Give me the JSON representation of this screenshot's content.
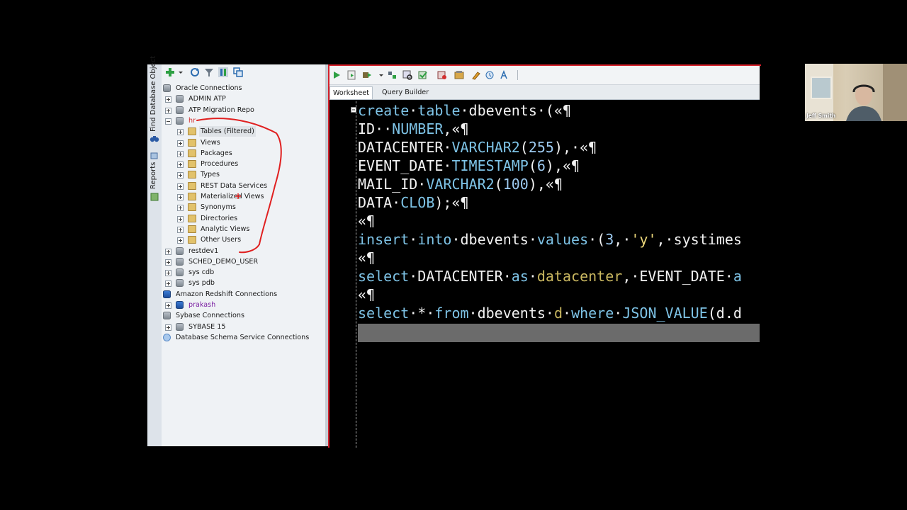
{
  "side_tabs": {
    "find": "Find Database Object",
    "reports": "Reports"
  },
  "connections": {
    "toolbar_icons": [
      "add-icon",
      "dropdown-icon",
      "refresh-icon",
      "filter-icon",
      "schema-browser-icon",
      "collapse-icon"
    ],
    "tree": [
      {
        "label": "Oracle Connections",
        "level": 0,
        "icon": "db-group",
        "expander": "none",
        "color": "#1a1a1a"
      },
      {
        "label": "ADMIN ATP",
        "level": 1,
        "icon": "db",
        "expander": "plus",
        "color": "#1a1a1a"
      },
      {
        "label": "ATP Migration Repo",
        "level": 1,
        "icon": "db",
        "expander": "plus",
        "color": "#1a1a1a"
      },
      {
        "label": "hr",
        "level": 1,
        "icon": "db",
        "expander": "minus",
        "color": "#d32f2f"
      },
      {
        "label": "Tables (Filtered)",
        "level": 2,
        "icon": "folder",
        "expander": "plus",
        "color": "#1a1a1a",
        "highlight": true
      },
      {
        "label": "Views",
        "level": 2,
        "icon": "folder",
        "expander": "plus",
        "color": "#1a1a1a"
      },
      {
        "label": "Packages",
        "level": 2,
        "icon": "folder",
        "expander": "plus",
        "color": "#1a1a1a"
      },
      {
        "label": "Procedures",
        "level": 2,
        "icon": "folder",
        "expander": "plus",
        "color": "#1a1a1a"
      },
      {
        "label": "Types",
        "level": 2,
        "icon": "folder",
        "expander": "plus",
        "color": "#1a1a1a"
      },
      {
        "label": "REST Data Services",
        "level": 2,
        "icon": "folder",
        "expander": "plus",
        "color": "#1a1a1a"
      },
      {
        "label": "Materialized Views",
        "level": 2,
        "icon": "folder",
        "expander": "plus",
        "color": "#1a1a1a"
      },
      {
        "label": "Synonyms",
        "level": 2,
        "icon": "folder",
        "expander": "plus",
        "color": "#1a1a1a"
      },
      {
        "label": "Directories",
        "level": 2,
        "icon": "folder",
        "expander": "plus",
        "color": "#1a1a1a"
      },
      {
        "label": "Analytic Views",
        "level": 2,
        "icon": "folder",
        "expander": "plus",
        "color": "#1a1a1a"
      },
      {
        "label": "Other Users",
        "level": 2,
        "icon": "folder",
        "expander": "plus",
        "color": "#1a1a1a"
      },
      {
        "label": "restdev1",
        "level": 1,
        "icon": "db",
        "expander": "plus",
        "color": "#1a1a1a"
      },
      {
        "label": "SCHED_DEMO_USER",
        "level": 1,
        "icon": "db",
        "expander": "plus",
        "color": "#1a1a1a"
      },
      {
        "label": "sys cdb",
        "level": 1,
        "icon": "db",
        "expander": "plus",
        "color": "#1a1a1a"
      },
      {
        "label": "sys pdb",
        "level": 1,
        "icon": "db",
        "expander": "plus",
        "color": "#1a1a1a"
      },
      {
        "label": "Amazon Redshift Connections",
        "level": 0,
        "icon": "redshift-group",
        "expander": "none",
        "color": "#1a1a1a"
      },
      {
        "label": "prakash",
        "level": 1,
        "icon": "redshift",
        "expander": "plus",
        "color": "#7b1fa2"
      },
      {
        "label": "Sybase Connections",
        "level": 0,
        "icon": "db-group",
        "expander": "none",
        "color": "#1a1a1a"
      },
      {
        "label": "SYBASE 15",
        "level": 1,
        "icon": "db",
        "expander": "plus",
        "color": "#1a1a1a"
      },
      {
        "label": "Database Schema Service Connections",
        "level": 0,
        "icon": "cloud",
        "expander": "none",
        "color": "#1a1a1a"
      }
    ]
  },
  "editor": {
    "toolbar_icons": [
      "run-statement-icon",
      "run-script-icon",
      "autotrace-icon",
      "dropdown-icon",
      "explain-plan-icon",
      "sql-tuning-icon",
      "commit-icon",
      "rollback-icon",
      "unshared-sql-icon",
      "clear-icon",
      "sql-history-icon",
      "format-icon"
    ],
    "tabs": [
      {
        "label": "Worksheet",
        "active": true
      },
      {
        "label": "Query Builder",
        "active": false
      }
    ],
    "code_lines": [
      [
        [
          "create",
          "kw"
        ],
        [
          "·",
          "t"
        ],
        [
          "table",
          "kw"
        ],
        [
          "·dbevents·(«¶",
          "t"
        ]
      ],
      [
        [
          "ID··",
          "t"
        ],
        [
          "NUMBER",
          "kw"
        ],
        [
          ",«¶",
          "t"
        ]
      ],
      [
        [
          "DATACENTER·",
          "t"
        ],
        [
          "VARCHAR2",
          "kw"
        ],
        [
          "(",
          "t"
        ],
        [
          "255",
          "num"
        ],
        [
          "),·«¶",
          "t"
        ]
      ],
      [
        [
          "EVENT_DATE·",
          "t"
        ],
        [
          "TIMESTAMP",
          "kw"
        ],
        [
          "(",
          "t"
        ],
        [
          "6",
          "num"
        ],
        [
          "),«¶",
          "t"
        ]
      ],
      [
        [
          "MAIL_ID·",
          "t"
        ],
        [
          "VARCHAR2",
          "kw"
        ],
        [
          "(",
          "t"
        ],
        [
          "100",
          "num"
        ],
        [
          "),«¶",
          "t"
        ]
      ],
      [
        [
          "DATA·",
          "t"
        ],
        [
          "CLOB",
          "kw"
        ],
        [
          ");«¶",
          "t"
        ]
      ],
      [
        [
          "«¶",
          "t"
        ]
      ],
      [
        [
          "insert",
          "kw"
        ],
        [
          "·",
          "t"
        ],
        [
          "into",
          "kw"
        ],
        [
          "·dbevents·",
          "t"
        ],
        [
          "values",
          "kw"
        ],
        [
          "·(",
          "t"
        ],
        [
          "3",
          "num"
        ],
        [
          ",·",
          "t"
        ],
        [
          "'y'",
          "str"
        ],
        [
          ",·systimes",
          "t"
        ]
      ],
      [
        [
          "«¶",
          "t"
        ]
      ],
      [
        [
          "select",
          "kw"
        ],
        [
          "·DATACENTER·",
          "t"
        ],
        [
          "as",
          "kw"
        ],
        [
          "·",
          "t"
        ],
        [
          "datacenter",
          "ali"
        ],
        [
          ",·EVENT_DATE·",
          "t"
        ],
        [
          "a",
          "kw"
        ]
      ],
      [
        [
          "«¶",
          "t"
        ]
      ],
      [
        [
          "select",
          "kw"
        ],
        [
          "·*·",
          "t"
        ],
        [
          "from",
          "kw"
        ],
        [
          "·dbevents·",
          "t"
        ],
        [
          "d",
          "ali"
        ],
        [
          "·",
          "t"
        ],
        [
          "where",
          "kw"
        ],
        [
          "·",
          "t"
        ],
        [
          "JSON_VALUE",
          "kw"
        ],
        [
          "(d.d",
          "t"
        ]
      ]
    ]
  },
  "webcam": {
    "name": "Jeff Smith"
  },
  "colors": {
    "annotation": "#e02020",
    "editor_border": "#d4202a",
    "keyword": "#7ec3e6",
    "string": "#ecd77a"
  }
}
